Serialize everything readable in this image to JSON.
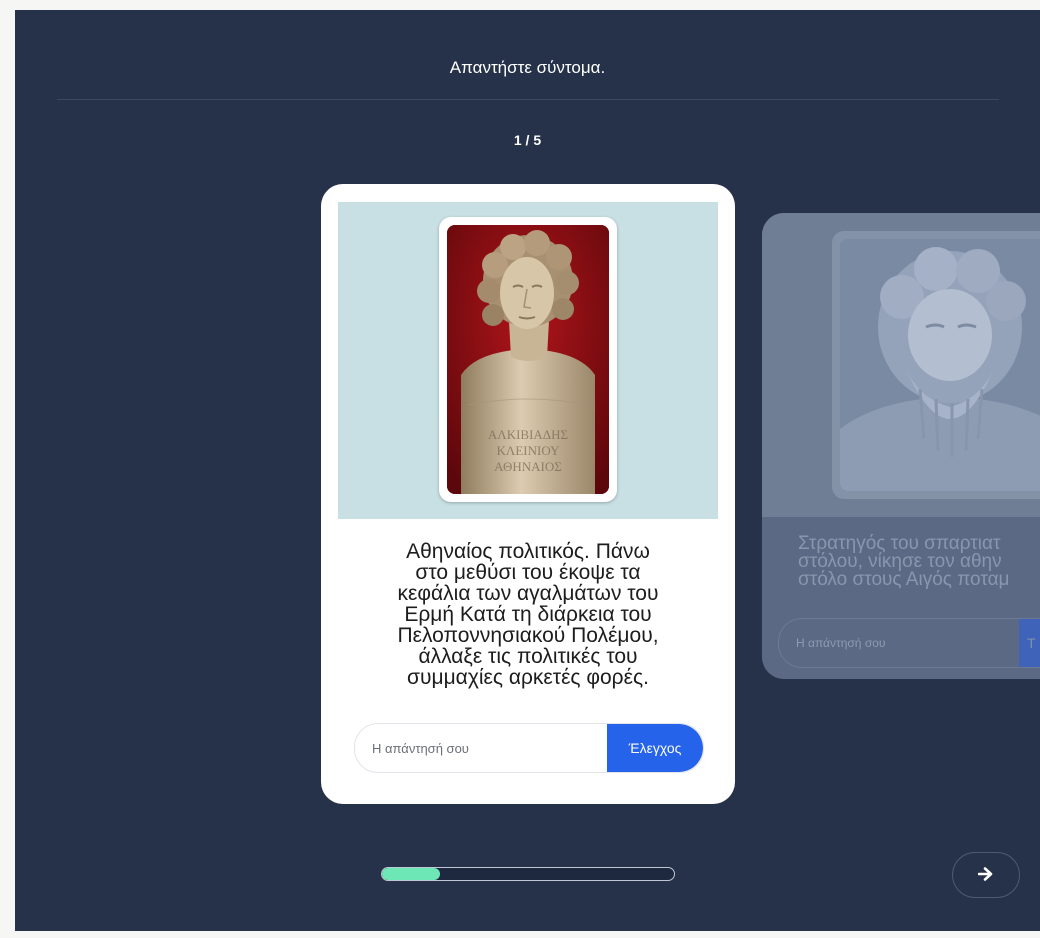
{
  "instruction": "Απαντήστε σύντομα.",
  "counter": "1 / 5",
  "progress": {
    "fraction": 0.2,
    "color": "#6ee7b7"
  },
  "colors": {
    "stage": "#263249",
    "accent": "#2563eb"
  },
  "active_card": {
    "image_icon": "marble-bust-photo",
    "bust_inscription": [
      "ΑΛΚΙΒΙΑΔΗΣ",
      "ΚΛΕΙΝΙΟΥ",
      "ΑΘΗΝΑΙΟΣ"
    ],
    "clue_lines": [
      "Αθηναίος πολιτικός. Πάνω",
      "στο μεθύσι του έκοψε τα",
      "κεφάλια των αγαλμάτων του",
      "Ερμή Κατά τη διάρκεια του",
      "Πελοποννησιακού Πολέμου,",
      "άλλαξε τις πολιτικές του",
      "συμμαχίες αρκετές φορές."
    ],
    "answer_placeholder": "Η απάντησή σου",
    "check_label": "Έλεγχος"
  },
  "next_card": {
    "image_icon": "bearded-bust-photo",
    "clue_lines": [
      "Στρατηγός του σπαρτιατ",
      "στόλου, νίκησε τον αθην",
      "στόλο στους Αιγός ποταμ"
    ],
    "answer_placeholder": "Η απάντησή σου",
    "check_label": "Τ"
  },
  "next_button_icon": "arrow-right-icon"
}
